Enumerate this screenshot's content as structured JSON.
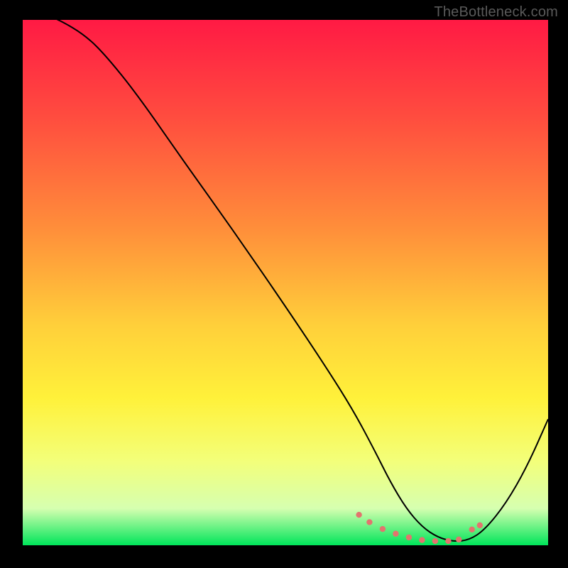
{
  "watermark": "TheBottleneck.com",
  "chart_data": {
    "type": "line",
    "title": "",
    "xlabel": "",
    "ylabel": "",
    "xlim": [
      0,
      100
    ],
    "ylim": [
      0,
      100
    ],
    "grid": false,
    "background_gradient": {
      "stops": [
        {
          "offset": 0,
          "color": "#ff1a44"
        },
        {
          "offset": 18,
          "color": "#ff4b3f"
        },
        {
          "offset": 40,
          "color": "#ff8f3a"
        },
        {
          "offset": 58,
          "color": "#ffcf3a"
        },
        {
          "offset": 72,
          "color": "#fff13a"
        },
        {
          "offset": 84,
          "color": "#f3ff7a"
        },
        {
          "offset": 93,
          "color": "#d6ffb0"
        },
        {
          "offset": 100,
          "color": "#00e55a"
        }
      ]
    },
    "series": [
      {
        "name": "bottleneck-curve",
        "color": "#000000",
        "x": [
          0,
          3,
          7,
          12,
          16,
          22,
          30,
          40,
          50,
          58,
          63,
          67,
          70,
          73,
          76,
          79,
          82,
          85,
          88,
          92,
          96,
          100
        ],
        "y": [
          102,
          101.5,
          100,
          97,
          93,
          85.5,
          74,
          60,
          45.5,
          33.5,
          25.5,
          18,
          12,
          7,
          3.5,
          1.5,
          0.7,
          1,
          3,
          8,
          15,
          24
        ]
      }
    ],
    "markers": {
      "name": "optimum-band",
      "color": "#e2746e",
      "radius": 4.2,
      "points": [
        {
          "x": 64,
          "y": 5.8
        },
        {
          "x": 66,
          "y": 4.4
        },
        {
          "x": 68.5,
          "y": 3.1
        },
        {
          "x": 71,
          "y": 2.2
        },
        {
          "x": 73.5,
          "y": 1.5
        },
        {
          "x": 76,
          "y": 1.0
        },
        {
          "x": 78.5,
          "y": 0.8
        },
        {
          "x": 81,
          "y": 0.8
        },
        {
          "x": 83,
          "y": 1.1
        },
        {
          "x": 85.5,
          "y": 3.0
        },
        {
          "x": 87,
          "y": 3.8
        }
      ]
    }
  }
}
